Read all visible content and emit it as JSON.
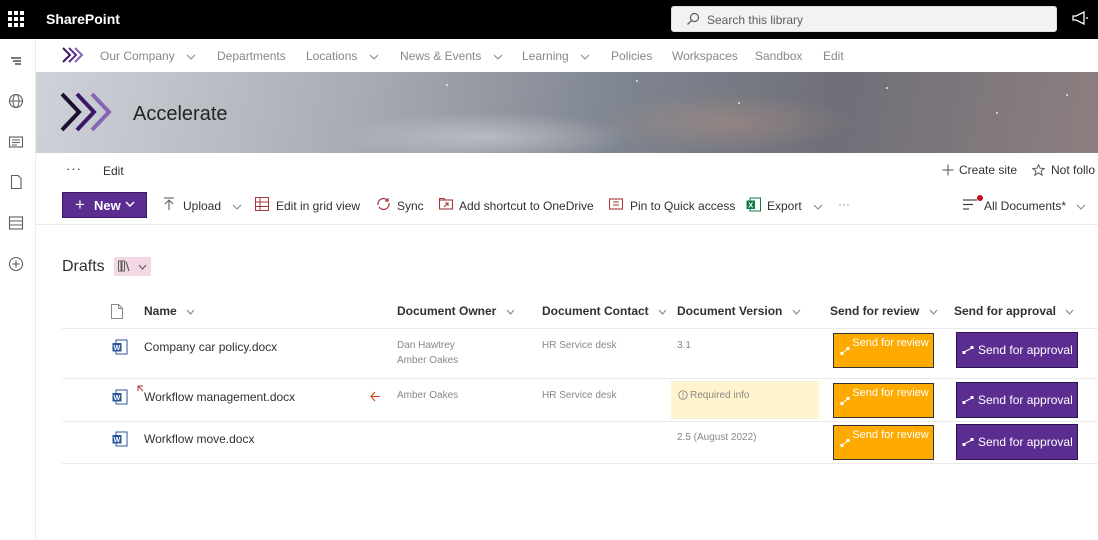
{
  "suite": {
    "brand": "SharePoint",
    "search_placeholder": "Search this library"
  },
  "hubnav": {
    "items": [
      {
        "label": "Our Company",
        "dropdown": true
      },
      {
        "label": "Departments",
        "dropdown": false
      },
      {
        "label": "Locations",
        "dropdown": true
      },
      {
        "label": "News & Events",
        "dropdown": true
      },
      {
        "label": "Learning",
        "dropdown": true
      },
      {
        "label": "Policies",
        "dropdown": false
      },
      {
        "label": "Workspaces",
        "dropdown": false
      },
      {
        "label": "Sandbox",
        "dropdown": false
      },
      {
        "label": "Edit",
        "dropdown": false
      }
    ]
  },
  "site": {
    "title": "Accelerate"
  },
  "command_row": {
    "more": "···",
    "edit": "Edit",
    "create_site": "Create site",
    "not_following": "Not follo"
  },
  "toolbar": {
    "new": "New",
    "upload": "Upload",
    "grid_view": "Edit in grid view",
    "sync": "Sync",
    "shortcut": "Add shortcut to OneDrive",
    "pin": "Pin to Quick access",
    "export": "Export",
    "more": "···",
    "view": "All Documents*"
  },
  "library": {
    "title": "Drafts",
    "columns": {
      "name": "Name",
      "owner": "Document Owner",
      "contact": "Document Contact",
      "version": "Document Version",
      "review": "Send for review",
      "approval": "Send for approval"
    },
    "rows": [
      {
        "name": "Company car policy.docx",
        "owner_1": "Dan Hawtrey",
        "owner_2": "Amber Oakes",
        "contact": "HR Service desk",
        "version": "3.1",
        "review_btn": "Send for review",
        "approval_btn": "Send for approval"
      },
      {
        "name": "Workflow management.docx",
        "owner_1": "Amber Oakes",
        "contact": "HR Service desk",
        "version": "Required info",
        "review_btn": "Send for review",
        "approval_btn": "Send for approval"
      },
      {
        "name": "Workflow move.docx",
        "version": "2.5 (August 2022)",
        "review_btn": "Send for review",
        "approval_btn": "Send for approval"
      }
    ]
  },
  "colors": {
    "brand_purple": "#5c2d91",
    "review_orange": "#ffaa00",
    "required_bg": "#fff4ce",
    "suitebar": "#000000"
  }
}
